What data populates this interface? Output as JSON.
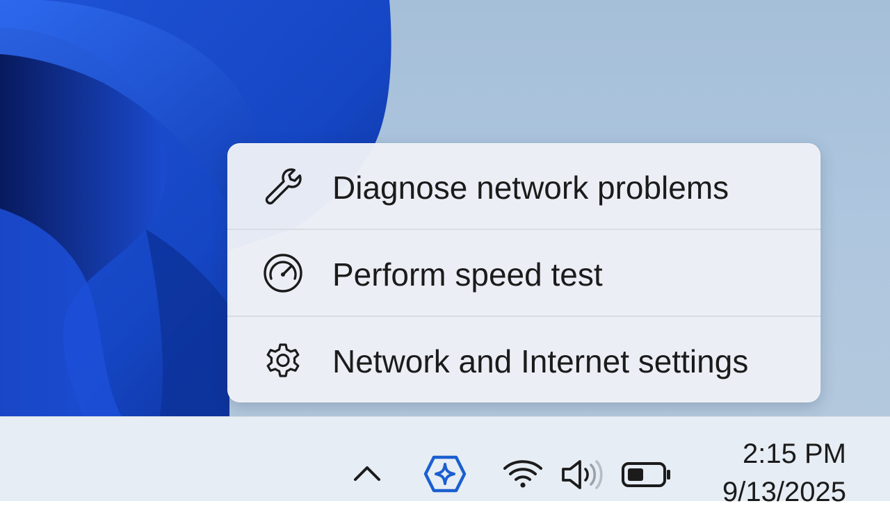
{
  "context_menu": {
    "items": [
      {
        "label": "Diagnose network problems",
        "icon": "wrench-icon"
      },
      {
        "label": "Perform speed test",
        "icon": "speedometer-icon"
      },
      {
        "label": "Network and Internet settings",
        "icon": "gear-icon"
      }
    ]
  },
  "taskbar": {
    "tray_icons": [
      "chevron-up-icon",
      "copilot-icon",
      "wifi-icon",
      "volume-icon",
      "battery-icon"
    ],
    "clock": {
      "time": "2:15 PM",
      "date": "9/13/2025"
    }
  },
  "colors": {
    "accent": "#1b5fd0",
    "menu_background": "#eceff6",
    "taskbar_background": "#e7edf4",
    "text": "#1b1b1b"
  }
}
